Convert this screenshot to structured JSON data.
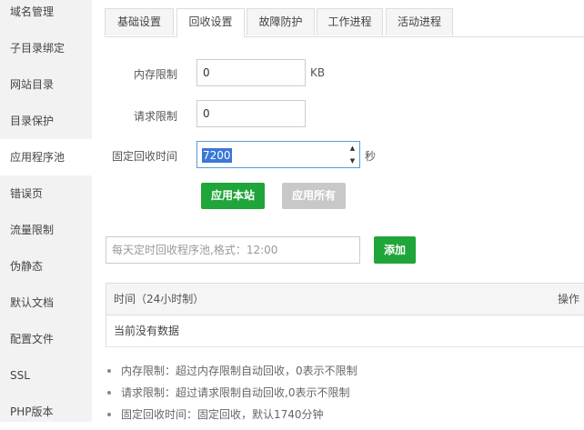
{
  "sidebar": {
    "items": [
      {
        "label": "域名管理"
      },
      {
        "label": "子目录绑定"
      },
      {
        "label": "网站目录"
      },
      {
        "label": "目录保护"
      },
      {
        "label": "应用程序池"
      },
      {
        "label": "错误页"
      },
      {
        "label": "流量限制"
      },
      {
        "label": "伪静态"
      },
      {
        "label": "默认文档"
      },
      {
        "label": "配置文件"
      },
      {
        "label": "SSL"
      },
      {
        "label": "PHP版本"
      }
    ],
    "active_index": 4
  },
  "tabs": [
    {
      "label": "基础设置"
    },
    {
      "label": "回收设置"
    },
    {
      "label": "故障防护"
    },
    {
      "label": "工作进程"
    },
    {
      "label": "活动进程"
    }
  ],
  "form": {
    "memory_label": "内存限制",
    "memory_value": "0",
    "memory_unit": "KB",
    "request_label": "请求限制",
    "request_value": "0",
    "fixed_label": "固定回收时间",
    "fixed_value": "7200",
    "fixed_unit": "秒"
  },
  "buttons": {
    "apply_site": "应用本站",
    "apply_all": "应用所有",
    "add": "添加"
  },
  "schedule": {
    "placeholder": "每天定时回收程序池,格式：12:00"
  },
  "table": {
    "col_time": "时间（24小时制）",
    "col_action": "操作",
    "empty_text": "当前没有数据"
  },
  "notes": [
    "内存限制：超过内存限制自动回收，0表示不限制",
    "请求限制：超过请求限制自动回收,0表示不限制",
    "固定回收时间：固定回收，默认1740分钟"
  ],
  "colors": {
    "accent_green": "#20a53a",
    "disabled_gray": "#c8c8c8",
    "selection_blue": "#3a78d6"
  }
}
